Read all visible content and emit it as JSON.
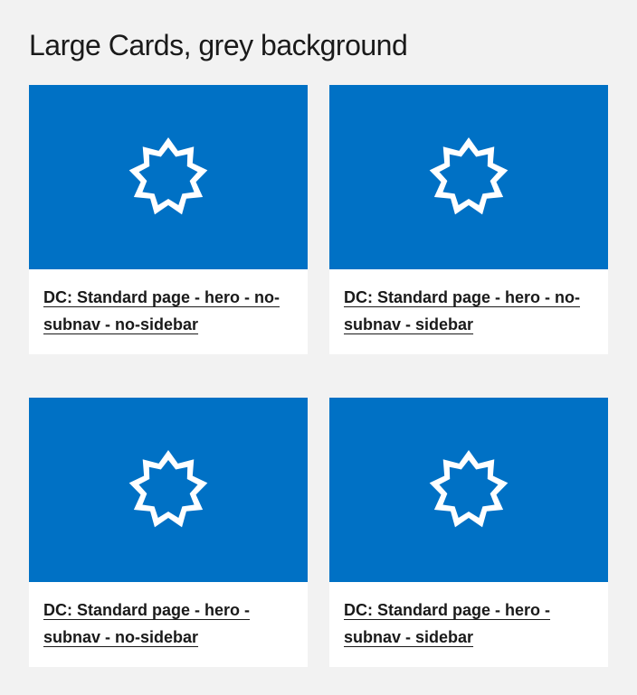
{
  "section": {
    "title": "Large Cards, grey background"
  },
  "cards": [
    {
      "title": "DC: Standard page - hero - no-subnav - no-sidebar",
      "icon": "nine-point-star-icon"
    },
    {
      "title": "DC: Standard page - hero - no-subnav - sidebar",
      "icon": "nine-point-star-icon"
    },
    {
      "title": "DC: Standard page - hero - subnav - no-sidebar",
      "icon": "nine-point-star-icon"
    },
    {
      "title": "DC: Standard page - hero - subnav - sidebar",
      "icon": "nine-point-star-icon"
    }
  ],
  "colors": {
    "page_background": "#f2f2f2",
    "media_background": "#0071c5",
    "card_background": "#ffffff",
    "text": "#1a1a1a"
  }
}
